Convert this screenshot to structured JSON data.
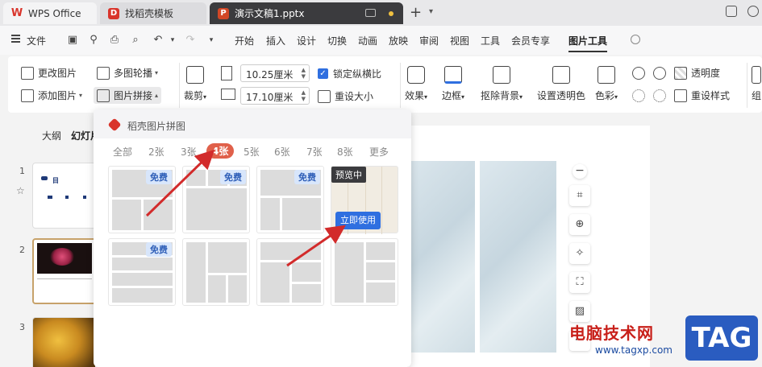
{
  "tabs": {
    "wps": "WPS Office",
    "template": "找稻壳模板",
    "document": "演示文稿1.pptx"
  },
  "menu": {
    "file": "文件",
    "items": [
      "开始",
      "插入",
      "设计",
      "切换",
      "动画",
      "放映",
      "审阅",
      "视图",
      "工具",
      "会员专享",
      "图片工具"
    ],
    "active": "图片工具"
  },
  "ribbon": {
    "change_picture": "更改图片",
    "multi_carousel": "多图轮播",
    "add_picture": "添加图片",
    "picture_collage": "图片拼接",
    "crop": "裁剪",
    "width_value": "10.25厘米",
    "height_value": "17.10厘米",
    "lock_ratio": "锁定纵横比",
    "reset_size": "重设大小",
    "effects": "效果",
    "border": "边框",
    "remove_background": "抠除背景",
    "set_transparent_color": "设置透明色",
    "color": "色彩",
    "transparency": "透明度",
    "reset_style": "重设样式",
    "group_partial": "组"
  },
  "left_panel": {
    "outline_tab": "大纲",
    "slides_tab": "幻灯片",
    "slide_numbers": [
      "1",
      "2",
      "3"
    ],
    "thumb1_title": "目"
  },
  "collage_panel": {
    "title": "稻壳图片拼图",
    "filter_tabs": [
      "全部",
      "2张",
      "3张",
      "4张",
      "5张",
      "6张",
      "7张",
      "8张",
      "更多"
    ],
    "active_tab": "4张",
    "badge_free": "免费",
    "badge_preview": "预览中",
    "use_now": "立即使用"
  },
  "watermark": {
    "site_name": "电脑技术网",
    "url": "www.tagxp.com",
    "tag": "TAG"
  },
  "colors": {
    "accent_blue": "#2f6fe0",
    "active_tab_red": "#e0604a",
    "arrow_red": "#d22b2b",
    "free_badge_bg": "#d8e6fb"
  }
}
